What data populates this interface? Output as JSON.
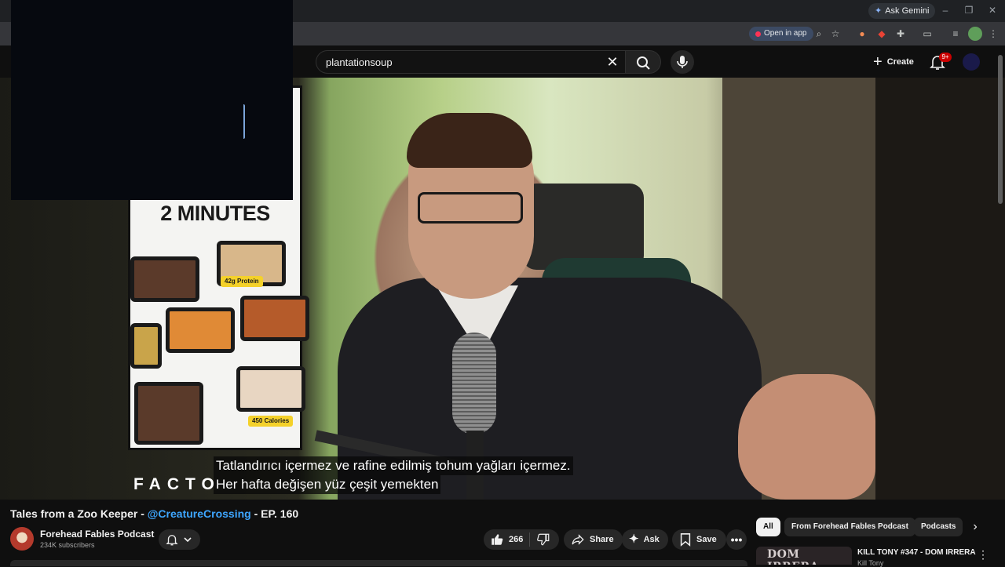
{
  "browser": {
    "ask_gemini": "Ask Gemini",
    "open_in_app": "Open in app"
  },
  "header": {
    "search_query": "plantationsoup",
    "create_label": "Create",
    "notifications_badge": "9+"
  },
  "video": {
    "ad_headline": "2 MINUTES",
    "ad_tag_protein": "42g Protein",
    "ad_tag_calories": "450 Calories",
    "ad_brand": "FACTO",
    "caption_line_1": "Tatlandırıcı içermez ve rafine edilmiş tohum yağları içermez.",
    "caption_line_2": "Her hafta değişen yüz çeşit yemekten"
  },
  "watch": {
    "title_prefix": "Tales from a Zoo Keeper - ",
    "title_mention": "@CreatureCrossing",
    "title_suffix": " - EP. 160",
    "channel_name": "Forehead Fables Podcast",
    "subscribers": "234K subscribers",
    "like_count": "266",
    "share_label": "Share",
    "ask_label": "Ask",
    "save_label": "Save"
  },
  "sidebar": {
    "chips": [
      "All",
      "From Forehead Fables Podcast",
      "Podcasts"
    ],
    "rec_thumb_text": "DOM IRRERA",
    "rec_title": "KILL TONY #347 - DOM IRRERA",
    "rec_channel": "Kill Tony"
  },
  "colors": {
    "background": "#0f0f0f",
    "accent_link": "#3ea6ff",
    "badge_red": "#cc0000"
  }
}
